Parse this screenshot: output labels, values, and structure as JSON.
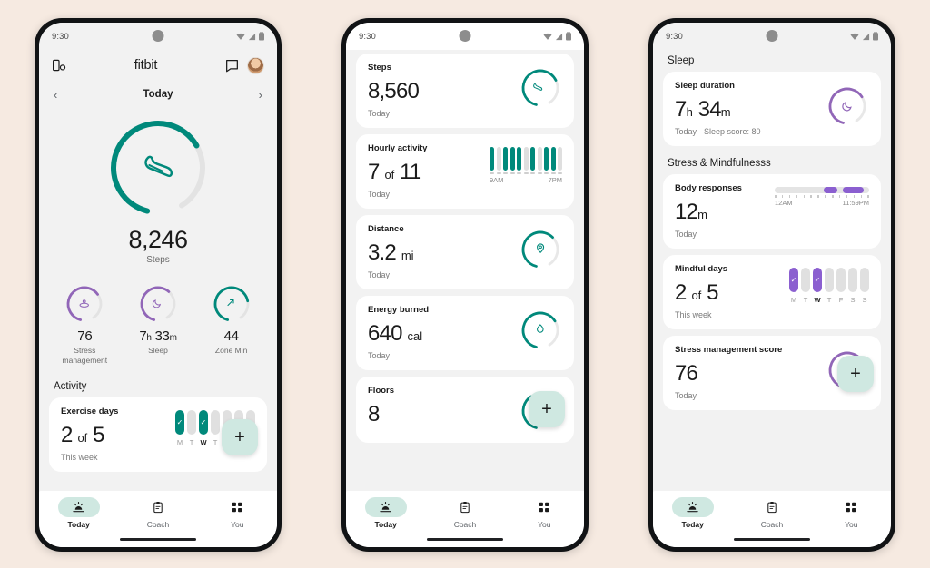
{
  "theme": {
    "background": "#f6eae1",
    "teal": "#00897b",
    "purple": "#8b5fd0",
    "purple_ring": "#9166b8",
    "track": "#e0e0e0",
    "card": "#ffffff",
    "screen": "#f2f2f2",
    "fab": "#cfe8e1"
  },
  "status_bar": {
    "time": "9:30",
    "icons": [
      "wifi-icon",
      "signal-icon",
      "battery-icon"
    ]
  },
  "bottom_nav": {
    "items": [
      {
        "label": "Today",
        "icon": "today-sunrise-icon",
        "active": true
      },
      {
        "label": "Coach",
        "icon": "clipboard-icon",
        "active": false
      },
      {
        "label": "You",
        "icon": "grid-squares-icon",
        "active": false
      }
    ]
  },
  "fab": {
    "label": "+",
    "name": "add-button"
  },
  "phone1": {
    "appbar": {
      "left_icon": "device-sync-icon",
      "brand": "fitbit",
      "message_icon": "chat-bubble-icon",
      "avatar": "user-avatar"
    },
    "day_nav": {
      "prev": "‹",
      "label": "Today",
      "next": "›"
    },
    "hero": {
      "icon": "shoe-icon",
      "value": "8,246",
      "label": "Steps",
      "progress": 72,
      "color": "#00897b"
    },
    "metrics": [
      {
        "icon": "stress-lotus-icon",
        "value": "76",
        "unit": "",
        "label": "Stress\nmanagement",
        "progress": 70,
        "color": "#9166b8"
      },
      {
        "icon": "sleep-moon-icon",
        "value": "7",
        "unit": "h",
        "value2": "33",
        "unit2": "m",
        "label": "Sleep",
        "progress": 66,
        "color": "#9166b8"
      },
      {
        "icon": "zone-minutes-icon",
        "value": "44",
        "unit": "",
        "label": "Zone Min",
        "progress": 78,
        "color": "#00897b"
      }
    ],
    "activity": {
      "section_title": "Activity",
      "card": {
        "title": "Exercise days",
        "value": "2",
        "of": "of",
        "goal": "5",
        "sub": "This week",
        "days": [
          {
            "letter": "M",
            "filled": true,
            "check": true,
            "today": false
          },
          {
            "letter": "T",
            "filled": false,
            "check": false,
            "today": false
          },
          {
            "letter": "W",
            "filled": true,
            "check": true,
            "today": true
          },
          {
            "letter": "T",
            "filled": false,
            "check": false,
            "today": false
          },
          {
            "letter": "F",
            "filled": false,
            "check": false,
            "today": false
          },
          {
            "letter": "S",
            "filled": false,
            "check": false,
            "today": false
          },
          {
            "letter": "S",
            "filled": false,
            "check": false,
            "today": false
          }
        ]
      }
    }
  },
  "phone2": {
    "cards": [
      {
        "title": "Steps",
        "value": "8,560",
        "unit": "",
        "sub": "Today",
        "ring": {
          "icon": "shoe-icon",
          "progress": 72,
          "color": "#00897b"
        }
      },
      {
        "title": "Distance",
        "value": "3.2",
        "unit": "mi",
        "sub": "Today",
        "ring": {
          "icon": "location-pin-icon",
          "progress": 66,
          "color": "#00897b"
        }
      },
      {
        "title": "Energy burned",
        "value": "640",
        "unit": "cal",
        "sub": "Today",
        "ring": {
          "icon": "flame-icon",
          "progress": 70,
          "color": "#00897b"
        }
      },
      {
        "title": "Floors",
        "value": "8",
        "unit": "",
        "sub": "",
        "ring": {
          "icon": "",
          "progress": 38,
          "color": "#00897b"
        }
      }
    ],
    "hourly": {
      "title": "Hourly activity",
      "value": "7",
      "of": "of",
      "goal": "11",
      "sub": "Today",
      "start_label": "9AM",
      "end_label": "7PM",
      "bars": [
        1,
        0,
        1,
        1,
        1,
        0,
        1,
        0,
        1,
        1,
        0
      ]
    }
  },
  "phone3": {
    "sleep_section": "Sleep",
    "sleep_card": {
      "title": "Sleep duration",
      "hours": "7",
      "h_unit": "h",
      "minutes": "34",
      "m_unit": "m",
      "sub": "Today · Sleep score: 80",
      "ring": {
        "icon": "sleep-moon-icon",
        "progress": 70,
        "color": "#9166b8"
      }
    },
    "stress_section": "Stress & Mindfulnesss",
    "body_responses": {
      "title": "Body responses",
      "value": "12",
      "unit": "m",
      "sub": "Today",
      "start_label": "12AM",
      "end_label": "11:59PM",
      "segments": [
        {
          "left_pct": 52,
          "width_pct": 14
        },
        {
          "left_pct": 72,
          "width_pct": 22
        }
      ]
    },
    "mindful_days": {
      "title": "Mindful days",
      "value": "2",
      "of": "of",
      "goal": "5",
      "sub": "This week",
      "days": [
        {
          "letter": "M",
          "filled": true,
          "check": true,
          "today": false
        },
        {
          "letter": "T",
          "filled": false,
          "check": false,
          "today": false
        },
        {
          "letter": "W",
          "filled": true,
          "check": true,
          "today": true
        },
        {
          "letter": "T",
          "filled": false,
          "check": false,
          "today": false
        },
        {
          "letter": "F",
          "filled": false,
          "check": false,
          "today": false
        },
        {
          "letter": "S",
          "filled": false,
          "check": false,
          "today": false
        },
        {
          "letter": "S",
          "filled": false,
          "check": false,
          "today": false
        }
      ]
    },
    "stress_score": {
      "title": "Stress management score",
      "value": "76",
      "sub": "Today",
      "ring": {
        "icon": "stress-lotus-icon",
        "progress": 72,
        "color": "#9166b8"
      }
    }
  }
}
